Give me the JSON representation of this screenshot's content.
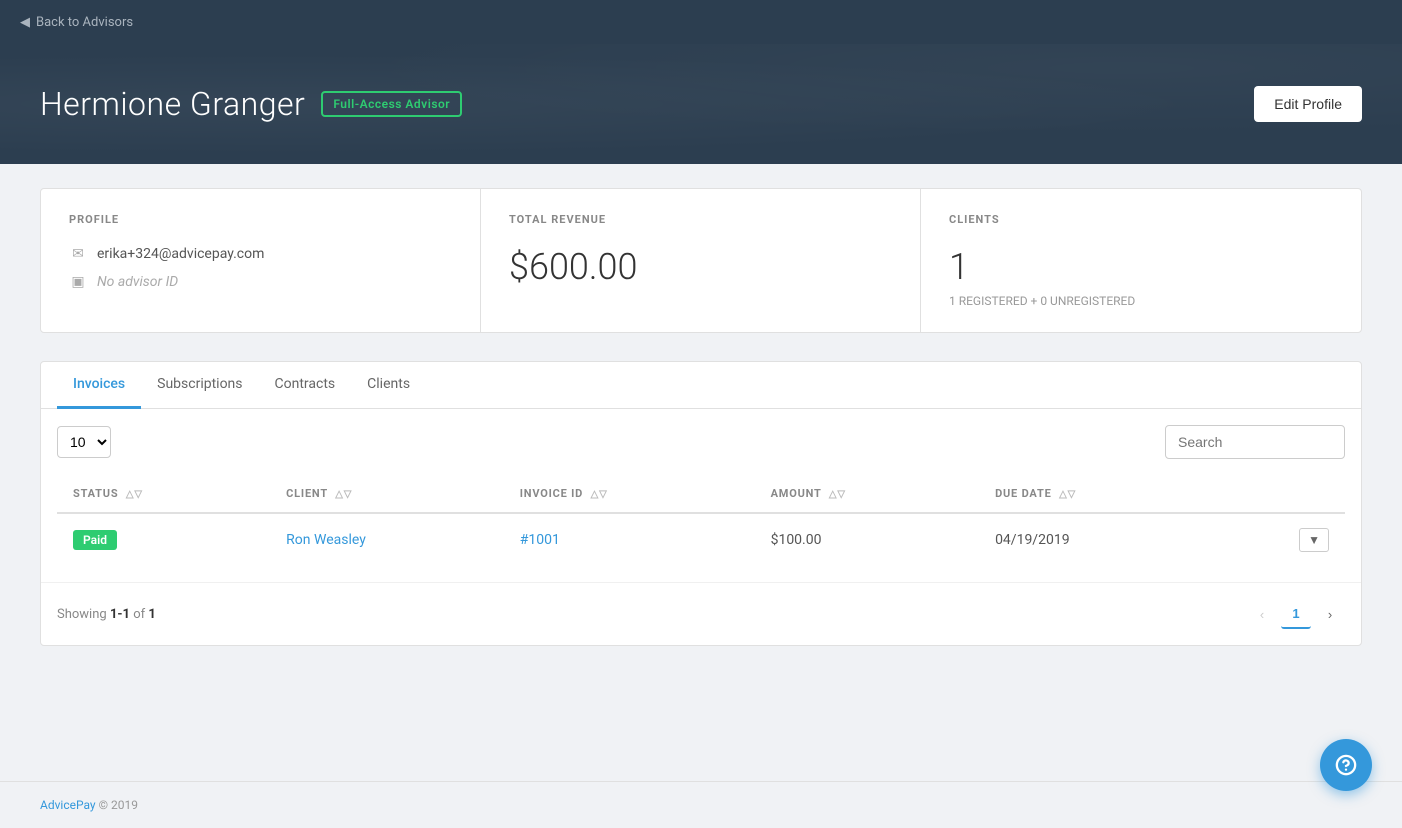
{
  "topnav": {
    "back_label": "Back to Advisors"
  },
  "header": {
    "name": "Hermione Granger",
    "badge": "Full-Access Advisor",
    "edit_button": "Edit Profile"
  },
  "stats": {
    "profile": {
      "label": "PROFILE",
      "email": "erika+324@advicepay.com",
      "advisor_id": "No advisor ID"
    },
    "revenue": {
      "label": "TOTAL REVENUE",
      "value": "$600.00"
    },
    "clients": {
      "label": "CLIENTS",
      "count": "1",
      "registered": "1 REGISTERED + 0 UNREGISTERED"
    }
  },
  "tabs": [
    {
      "label": "Invoices",
      "active": true
    },
    {
      "label": "Subscriptions",
      "active": false
    },
    {
      "label": "Contracts",
      "active": false
    },
    {
      "label": "Clients",
      "active": false
    }
  ],
  "table": {
    "page_size": "10",
    "search_placeholder": "Search",
    "columns": [
      {
        "label": "STATUS",
        "key": "status"
      },
      {
        "label": "CLIENT",
        "key": "client"
      },
      {
        "label": "INVOICE ID",
        "key": "invoice_id"
      },
      {
        "label": "AMOUNT",
        "key": "amount"
      },
      {
        "label": "DUE DATE",
        "key": "due_date"
      }
    ],
    "rows": [
      {
        "status": "Paid",
        "client": "Ron Weasley",
        "invoice_id": "#1001",
        "amount": "$100.00",
        "due_date": "04/19/2019"
      }
    ],
    "showing": "Showing ",
    "showing_range": "1-1",
    "showing_of": " of ",
    "showing_total": "1",
    "page_current": "1"
  },
  "footer": {
    "brand": "AdvicePay",
    "copy": " © 2019"
  },
  "fab": {
    "icon": "?"
  }
}
